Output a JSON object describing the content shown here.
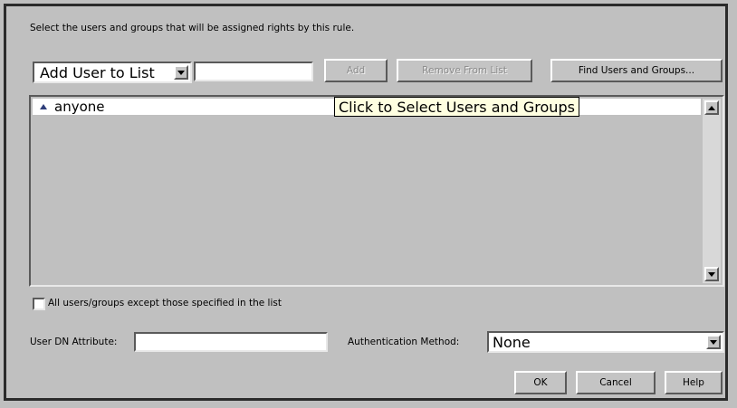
{
  "instruction": "Select the users and groups that will be assigned rights by this rule.",
  "toolbar": {
    "mode_dropdown": "Add User to List",
    "name_input_value": "",
    "add_label": "Add",
    "remove_label": "Remove From List",
    "find_label": "Find Users and Groups..."
  },
  "list": {
    "items": [
      {
        "label": "anyone",
        "icon": "user-icon"
      }
    ]
  },
  "tooltip": "Click to Select Users and Groups",
  "except_checkbox": {
    "label": "All users/groups except those specified in the list",
    "checked": false
  },
  "user_dn": {
    "label": "User DN Attribute:",
    "value": ""
  },
  "auth_method": {
    "label": "Authentication Method:",
    "value": "None"
  },
  "buttons": {
    "ok": "OK",
    "cancel": "Cancel",
    "help": "Help"
  }
}
